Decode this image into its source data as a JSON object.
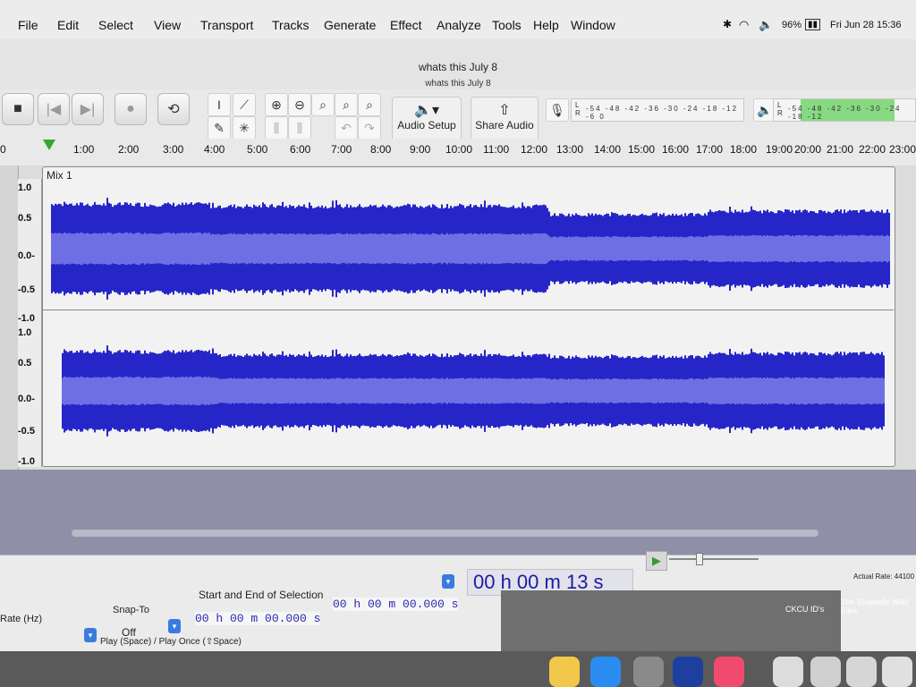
{
  "menubar": {
    "items": [
      "File",
      "Edit",
      "Select",
      "View",
      "Transport",
      "Tracks",
      "Generate",
      "Effect",
      "Analyze",
      "Tools",
      "Help",
      "Window"
    ],
    "battery": "96%",
    "clock": "Fri Jun 28 15:36"
  },
  "window": {
    "title": "whats this July 8",
    "subtitle": "whats this July 8"
  },
  "toolbar": {
    "audio_setup_label": "Audio Setup",
    "share_audio_label": "Share Audio",
    "record_meter_scale": "-54 -48 -42 -36 -30 -24 -18 -12 -6 0",
    "play_meter_scale": "-54 -48 -42 -36 -30 -24 -18 -12",
    "meter_lr": "L\nR",
    "play_meter_level": 0.85
  },
  "ruler": {
    "labels": [
      "0",
      "1:00",
      "2:00",
      "3:00",
      "4:00",
      "5:00",
      "6:00",
      "7:00",
      "8:00",
      "9:00",
      "10:00",
      "11:00",
      "12:00",
      "13:00",
      "14:00",
      "15:00",
      "16:00",
      "17:00",
      "18:00",
      "19:00",
      "20:00",
      "21:00",
      "22:00",
      "23:00"
    ]
  },
  "track": {
    "clip_name": "Mix 1",
    "scale_labels": [
      "1.0",
      "0.5",
      "0.0-",
      "-0.5",
      "-1.0"
    ]
  },
  "bottom": {
    "rate_label": "Rate (Hz)",
    "snap_label": "Snap-To",
    "snap_value": "Off",
    "selection_label": "Start and End of Selection",
    "start_time": "00 h 00 m 00.000 s",
    "end_time": "00 h 00 m 00.000 s",
    "position": "00 h 00 m 13 s",
    "hint": "Play (Space) / Play Once (⇧Space)",
    "actual_rate": "Actual Rate: 44100"
  },
  "desktop": {
    "file1": "CKCU ID's",
    "file2": "The Bluebells WAV Files"
  },
  "colors": {
    "wave": "#2626c8",
    "wave_rms": "#6f6fe4",
    "meter_green": "#73d46d"
  }
}
